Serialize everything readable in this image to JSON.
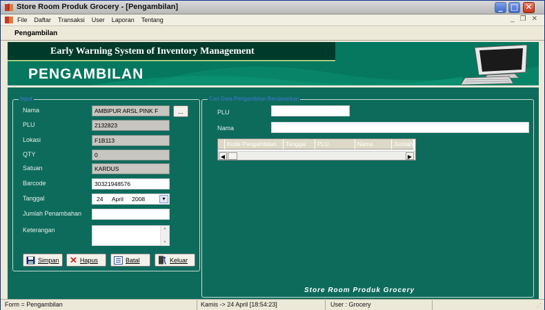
{
  "window": {
    "title": "Store Room Produk Grocery - [Pengambilan]",
    "controls": [
      "minimize",
      "maximize",
      "close"
    ]
  },
  "menu": {
    "items": [
      "File",
      "Daftar",
      "Transaksi",
      "User",
      "Laporan",
      "Tentang"
    ],
    "mdi_controls": [
      "_",
      "❒",
      "✕"
    ]
  },
  "child_title": "Pengambilan",
  "banner": {
    "subtitle": "Early Warning System of Inventory Management",
    "title": "PENGAMBILAN"
  },
  "input_group": {
    "title": "Input",
    "fields": {
      "nama": {
        "label": "Nama",
        "value": "AMBIPUR ARSL PINK F"
      },
      "plu": {
        "label": "PLU",
        "value": "2132823"
      },
      "lokasi": {
        "label": "Lokasi",
        "value": "F1B113"
      },
      "qty": {
        "label": "QTY",
        "value": "0"
      },
      "satuan": {
        "label": "Satuan",
        "value": "KARDUS"
      },
      "barcode": {
        "label": "Barcode",
        "value": "30321948576"
      },
      "tanggal": {
        "label": "Tanggal",
        "day": "24",
        "month": "April",
        "year": "2008"
      },
      "jumlah": {
        "label": "Jumlah Penambahan",
        "value": ""
      },
      "keterangan": {
        "label": "Keterangan",
        "value": ""
      }
    },
    "browse_button": "...",
    "buttons": {
      "simpan": "Simpan",
      "hapus": "Hapus",
      "batal": "Batal",
      "keluar": "Keluar"
    }
  },
  "search_group": {
    "title": "Cari Data Pengambilan Berdasarkan",
    "plu_label": "PLU",
    "nama_label": "Nama",
    "plu_value": "",
    "nama_value": "",
    "table_headers": [
      "Kode Pengambilan",
      "Tanggal",
      "PLU",
      "Nama",
      "Jumlah"
    ]
  },
  "footer_logo": "Store Room Produk Grocery",
  "status": {
    "form": "Form = Pengambilan",
    "datetime": "Kamis -> 24 April [18:54:23]",
    "user": "User : Grocery"
  },
  "colors": {
    "main_bg": "#0d6b5c",
    "banner_bg": "#05785f",
    "banner_dark": "#003a2a",
    "group_title": "#4477d8"
  }
}
